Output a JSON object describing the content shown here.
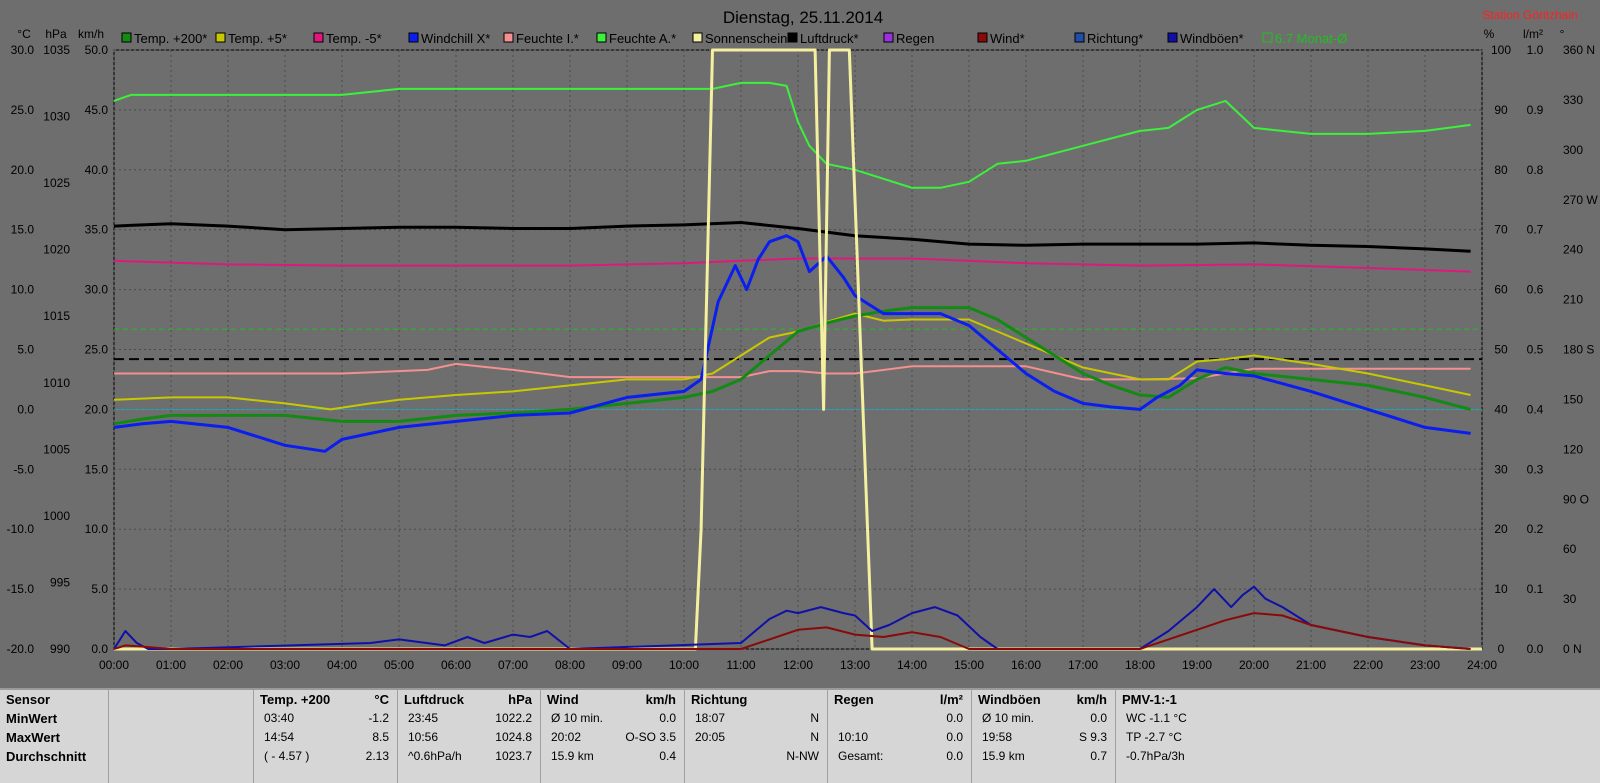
{
  "header": {
    "title": "Dienstag, 25.11.2014",
    "station": "Station Göritzhain"
  },
  "units": {
    "left1": "°C",
    "left2": "hPa",
    "left3": "km/h",
    "right1": "%",
    "right2": "l/m²",
    "right3": "°"
  },
  "legend": [
    {
      "label": "Temp. +200*",
      "color": "#138a13"
    },
    {
      "label": "Temp. +5*",
      "color": "#c8c800"
    },
    {
      "label": "Temp. -5*",
      "color": "#e0187e"
    },
    {
      "label": "Windchill X*",
      "color": "#0a1ef0"
    },
    {
      "label": "Feuchte I.*",
      "color": "#f49090"
    },
    {
      "label": "Feuchte A.*",
      "color": "#3cf03c"
    },
    {
      "label": "Sonnenschein",
      "color": "#f5f0a0"
    },
    {
      "label": "Luftdruck*",
      "color": "#000000"
    },
    {
      "label": "Regen",
      "color": "#9a30e0"
    },
    {
      "label": "Wind*",
      "color": "#8a0a0a"
    },
    {
      "label": "Richtung*",
      "color": "#1e4ea8"
    },
    {
      "label": "Windböen*",
      "color": "#1010a8"
    },
    {
      "label": "6.7 Monat-Ø",
      "color": "#20c020"
    }
  ],
  "chart_data": {
    "type": "line",
    "title": "Dienstag, 25.11.2014",
    "x_ticks": [
      "00:00",
      "01:00",
      "02:00",
      "03:00",
      "04:00",
      "05:00",
      "06:00",
      "07:00",
      "08:00",
      "09:00",
      "10:00",
      "11:00",
      "12:00",
      "13:00",
      "14:00",
      "15:00",
      "16:00",
      "17:00",
      "18:00",
      "19:00",
      "20:00",
      "21:00",
      "22:00",
      "23:00",
      "24:00"
    ],
    "xlim": [
      0,
      24
    ],
    "axes": {
      "temp_c": {
        "ticks": [
          "30.0",
          "25.0",
          "20.0",
          "15.0",
          "10.0",
          "5.0",
          "0.0",
          "-5.0",
          "-10.0",
          "-15.0",
          "-20.0"
        ],
        "range": [
          -20,
          30
        ]
      },
      "pressure_hpa": {
        "ticks": [
          "1035",
          "1030",
          "1025",
          "1020",
          "1015",
          "1010",
          "1005",
          "1000",
          "995",
          "990"
        ],
        "range": [
          990,
          1040
        ]
      },
      "wind_kmh": {
        "ticks": [
          "50.0",
          "45.0",
          "40.0",
          "35.0",
          "30.0",
          "25.0",
          "20.0",
          "15.0",
          "10.0",
          "5.0",
          "0.0"
        ],
        "range": [
          0,
          50
        ]
      },
      "humidity_pct": {
        "ticks": [
          "100",
          "90",
          "80",
          "70",
          "60",
          "50",
          "40",
          "30",
          "20",
          "10",
          "0"
        ],
        "range": [
          0,
          100
        ]
      },
      "rain_lm2": {
        "ticks": [
          "1.0",
          "0.9",
          "0.8",
          "0.7",
          "0.6",
          "0.5",
          "0.4",
          "0.3",
          "0.2",
          "0.1",
          "0.0"
        ],
        "range": [
          0,
          1
        ]
      },
      "direction_deg": {
        "ticks": [
          "360 N",
          "330",
          "300",
          "270 W",
          "240",
          "210",
          "180 S",
          "150",
          "120",
          "90 O",
          "60",
          "30",
          "0 N"
        ],
        "range": [
          0,
          360
        ]
      }
    },
    "reference_lines": [
      {
        "name": "6.7 Monat-Ø",
        "axis": "temp_c",
        "value": 6.7,
        "color": "#20c020"
      },
      {
        "name": "baseline",
        "axis": "temp_c",
        "value": 4.2,
        "color": "#000000"
      },
      {
        "name": "zero",
        "axis": "temp_c",
        "value": 0,
        "color": "#30a0b0"
      }
    ],
    "series": [
      {
        "name": "Feuchte A.*",
        "axis": "humidity_pct",
        "color": "#3cf03c",
        "width": 2,
        "x": [
          0,
          0.3,
          1,
          2,
          3,
          4,
          4.5,
          5,
          6,
          7,
          8,
          9,
          10,
          10.5,
          11,
          11.5,
          11.8,
          12,
          12.2,
          12.5,
          13,
          13.5,
          14,
          14.5,
          15,
          15.5,
          16,
          17,
          18,
          18.5,
          19,
          19.5,
          20,
          21,
          22,
          23,
          23.8
        ],
        "y": [
          91.5,
          92.5,
          92.5,
          92.5,
          92.5,
          92.5,
          93,
          93.5,
          93.5,
          93.5,
          93.5,
          93.5,
          93.5,
          93.5,
          94.5,
          94.5,
          94,
          88,
          84,
          81,
          80,
          78.5,
          77,
          77,
          78,
          81,
          81.5,
          84,
          86.5,
          87,
          90,
          91.5,
          87,
          86,
          86,
          86.5,
          87.5
        ]
      },
      {
        "name": "Luftdruck*",
        "axis": "pressure_hpa",
        "color": "#000000",
        "width": 3,
        "x": [
          0,
          1,
          2,
          3,
          4,
          5,
          6,
          7,
          8,
          9,
          10,
          11,
          12,
          13,
          14,
          15,
          16,
          17,
          18,
          19,
          20,
          21,
          22,
          23,
          23.8
        ],
        "y": [
          1025.3,
          1025.5,
          1025.3,
          1025.0,
          1025.1,
          1025.2,
          1025.2,
          1025.1,
          1025.1,
          1025.3,
          1025.4,
          1025.6,
          1025.1,
          1024.5,
          1024.2,
          1023.8,
          1023.7,
          1023.8,
          1023.8,
          1023.8,
          1023.9,
          1023.7,
          1023.6,
          1023.4,
          1023.2
        ]
      },
      {
        "name": "Temp. -5*",
        "axis": "temp_c",
        "color": "#e0187e",
        "width": 2,
        "x": [
          0,
          2,
          4,
          6,
          8,
          10,
          11,
          12,
          13,
          14,
          15,
          16,
          18,
          20,
          22,
          23.8
        ],
        "y": [
          12.4,
          12.1,
          12.0,
          12.0,
          12.0,
          12.2,
          12.4,
          12.6,
          12.6,
          12.6,
          12.4,
          12.2,
          12.0,
          12.1,
          11.8,
          11.5
        ]
      },
      {
        "name": "Feuchte I.*",
        "axis": "temp_c",
        "color": "#f49090",
        "width": 2,
        "x": [
          0,
          2,
          4,
          5.5,
          6,
          7,
          8,
          9,
          10,
          11,
          11.5,
          12,
          12.5,
          13,
          14,
          15,
          16,
          17,
          18,
          19,
          20,
          21,
          22,
          23.8
        ],
        "y": [
          3.0,
          3.0,
          3.0,
          3.3,
          3.8,
          3.3,
          2.7,
          2.7,
          2.7,
          2.7,
          3.2,
          3.2,
          3.0,
          3.0,
          3.6,
          3.6,
          3.6,
          2.5,
          2.5,
          2.6,
          3.4,
          3.4,
          3.4,
          3.4
        ]
      },
      {
        "name": "Temp. +5*",
        "axis": "temp_c",
        "color": "#c8c800",
        "width": 2,
        "x": [
          0,
          1,
          2,
          3,
          3.8,
          4.5,
          5,
          6,
          7,
          8,
          9,
          10,
          10.5,
          11,
          11.5,
          12,
          12.5,
          13,
          13.5,
          14,
          14.5,
          15,
          15.5,
          16,
          16.5,
          17,
          18,
          18.5,
          19,
          19.5,
          20,
          21,
          22,
          23,
          23.8
        ],
        "y": [
          0.8,
          1.0,
          1.0,
          0.5,
          0.0,
          0.5,
          0.8,
          1.2,
          1.5,
          2.0,
          2.5,
          2.5,
          3.0,
          4.5,
          6.0,
          6.5,
          7.3,
          8.0,
          7.4,
          7.5,
          7.5,
          7.5,
          6.5,
          5.5,
          4.5,
          3.5,
          2.5,
          2.5,
          4.0,
          4.2,
          4.5,
          3.8,
          3.0,
          2.0,
          1.2
        ]
      },
      {
        "name": "Temp. +200*",
        "axis": "temp_c",
        "color": "#138a13",
        "width": 3,
        "x": [
          0,
          0.5,
          1,
          2,
          3,
          4,
          5,
          6,
          7,
          8,
          9,
          10,
          10.5,
          11,
          11.5,
          12,
          12.5,
          13,
          13.5,
          14,
          14.5,
          15,
          15.5,
          16,
          16.5,
          17,
          17.5,
          18,
          18.5,
          19,
          19.5,
          20,
          21,
          22,
          23,
          23.8
        ],
        "y": [
          -1.2,
          -0.8,
          -0.5,
          -0.5,
          -0.5,
          -1.0,
          -1.0,
          -0.5,
          -0.3,
          0.0,
          0.5,
          1.0,
          1.5,
          2.5,
          4.5,
          6.5,
          7.2,
          7.8,
          8.2,
          8.5,
          8.5,
          8.5,
          7.5,
          6.0,
          4.5,
          3.0,
          2.0,
          1.2,
          1.0,
          2.5,
          3.5,
          3.0,
          2.5,
          2.0,
          1.0,
          0.0
        ]
      },
      {
        "name": "Windchill X*",
        "axis": "temp_c",
        "color": "#0a1ef0",
        "width": 3,
        "x": [
          0,
          0.5,
          1,
          2,
          3,
          3.7,
          4,
          4.5,
          5,
          6,
          7,
          8,
          9,
          10,
          10.3,
          10.6,
          10.9,
          11.1,
          11.3,
          11.5,
          11.8,
          12.0,
          12.2,
          12.5,
          12.8,
          13.0,
          13.5,
          14,
          14.5,
          15,
          15.5,
          16,
          16.5,
          17,
          17.5,
          18,
          18.3,
          18.7,
          19,
          19.5,
          20,
          21,
          22,
          23,
          23.8
        ],
        "y": [
          -1.5,
          -1.2,
          -1.0,
          -1.5,
          -3.0,
          -3.5,
          -2.5,
          -2.0,
          -1.5,
          -1.0,
          -0.5,
          -0.3,
          1.0,
          1.5,
          2.5,
          9.0,
          12.0,
          10.0,
          12.5,
          14.0,
          14.5,
          14.0,
          11.5,
          12.8,
          11.0,
          9.5,
          8.0,
          8.0,
          8.0,
          7.0,
          5.0,
          3.0,
          1.5,
          0.5,
          0.2,
          0.0,
          1.0,
          2.0,
          3.3,
          3.0,
          2.8,
          1.5,
          0.0,
          -1.5,
          -2.0
        ]
      },
      {
        "name": "Sonnenschein",
        "axis": "humidity_pct",
        "color": "#f5f0a0",
        "width": 3,
        "x": [
          0,
          10.2,
          10.3,
          10.5,
          12.3,
          12.45,
          12.55,
          12.7,
          12.9,
          13.3,
          24
        ],
        "y": [
          0,
          0,
          20,
          100,
          100,
          40,
          100,
          100,
          100,
          0,
          0
        ]
      },
      {
        "name": "Windböen*",
        "axis": "wind_kmh",
        "color": "#1010a8",
        "width": 2,
        "x": [
          0,
          0.2,
          0.4,
          0.6,
          1,
          4.5,
          5.0,
          5.8,
          6.2,
          6.5,
          7.0,
          7.3,
          7.6,
          8,
          11,
          11.5,
          11.8,
          12.0,
          12.4,
          12.8,
          13.0,
          13.3,
          13.6,
          14.0,
          14.4,
          14.8,
          15.2,
          15.5,
          18,
          18.5,
          19,
          19.3,
          19.6,
          19.8,
          20.0,
          20.2,
          20.5,
          21,
          22,
          23,
          23.8
        ],
        "y": [
          0,
          1.5,
          0.5,
          0,
          0,
          0.5,
          0.8,
          0.3,
          1.0,
          0.5,
          1.2,
          1.0,
          1.5,
          0,
          0.5,
          2.5,
          3.2,
          3.0,
          3.5,
          3.0,
          2.8,
          1.5,
          2.0,
          3.0,
          3.5,
          2.8,
          1.0,
          0,
          0,
          1.5,
          3.5,
          5.0,
          3.5,
          4.5,
          5.2,
          4.2,
          3.5,
          2.0,
          1.0,
          0.3,
          0
        ]
      },
      {
        "name": "Wind*",
        "axis": "wind_kmh",
        "color": "#8a0a0a",
        "width": 2,
        "x": [
          0,
          0.2,
          0.5,
          1,
          11,
          11.5,
          12.0,
          12.5,
          13.0,
          13.5,
          14.0,
          14.5,
          15,
          18,
          18.5,
          19,
          19.5,
          20.0,
          20.5,
          21,
          22,
          23,
          23.8
        ],
        "y": [
          0,
          0.3,
          0.2,
          0,
          0,
          0.8,
          1.6,
          1.8,
          1.2,
          1.0,
          1.4,
          1.0,
          0,
          0,
          0.8,
          1.6,
          2.4,
          3.0,
          2.8,
          2.0,
          1.0,
          0.3,
          0
        ]
      }
    ]
  },
  "table": {
    "labels": [
      "Sensor",
      "MinWert",
      "MaxWert",
      "Durchschnitt"
    ],
    "temp": {
      "title": "Temp. +200",
      "unit": "°C",
      "rows": [
        [
          "03:40",
          "-1.2"
        ],
        [
          "14:54",
          "8.5"
        ],
        [
          "( - 4.57 )",
          "2.13"
        ]
      ]
    },
    "pressure": {
      "title": "Luftdruck",
      "unit": "hPa",
      "rows": [
        [
          "23:45",
          "1022.2"
        ],
        [
          "10:56",
          "1024.8"
        ],
        [
          "^0.6hPa/h",
          "1023.7"
        ]
      ]
    },
    "wind": {
      "title": "Wind",
      "unit": "km/h",
      "rows": [
        [
          "Ø 10 min.",
          "",
          "0.0"
        ],
        [
          "20:02",
          "O-SO 3.5",
          ""
        ],
        [
          "15.9 km",
          "",
          "0.4"
        ]
      ]
    },
    "direction": {
      "title": "Richtung",
      "rows": [
        [
          "18:07",
          "N"
        ],
        [
          "20:05",
          "N"
        ],
        [
          "",
          "N-NW"
        ]
      ]
    },
    "rain": {
      "title": "Regen",
      "unit": "l/m²",
      "rows": [
        [
          "",
          "0.0"
        ],
        [
          "10:10",
          "0.0"
        ],
        [
          "Gesamt:",
          "0.0"
        ]
      ]
    },
    "gusts": {
      "title": "Windböen",
      "unit": "km/h",
      "rows": [
        [
          "Ø 10 min.",
          "",
          "0.0"
        ],
        [
          "19:58",
          "S 9.3",
          ""
        ],
        [
          "15.9 km",
          "",
          "0.7"
        ]
      ]
    },
    "pmv": {
      "title": "PMV-1:-1",
      "rows": [
        "WC -1.1 °C",
        "TP -2.7 °C",
        "-0.7hPa/3h"
      ]
    }
  }
}
